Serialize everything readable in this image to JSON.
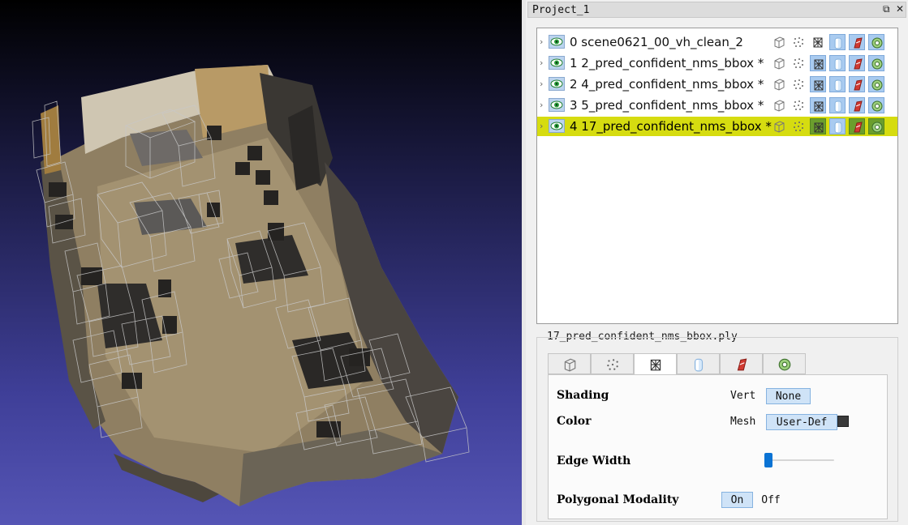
{
  "dock": {
    "title": "Project_1",
    "float_glyph": "⧉",
    "close_glyph": "✕"
  },
  "layers": [
    {
      "index": "0",
      "name": "scene0621_00_vh_clean_2",
      "selected": false
    },
    {
      "index": "1",
      "name": "2_pred_confident_nms_bbox *",
      "selected": false
    },
    {
      "index": "2",
      "name": "4_pred_confident_nms_bbox *",
      "selected": false
    },
    {
      "index": "3",
      "name": "5_pred_confident_nms_bbox *",
      "selected": false
    },
    {
      "index": "4",
      "name": "17_pred_confident_nms_bbox *",
      "selected": true
    }
  ],
  "layer_icons": [
    "box-icon",
    "points-icon",
    "wireframe-icon",
    "cylinder-icon",
    "red-brush-icon",
    "gear-icon"
  ],
  "properties": {
    "file_label": "17_pred_confident_nms_bbox.ply",
    "tabs": [
      "box-icon",
      "points-icon",
      "wireframe-icon",
      "cylinder-icon",
      "red-brush-icon",
      "gear-icon"
    ],
    "active_tab": 2,
    "shading_label": "Shading",
    "shading_mode": "Vert",
    "shading_value": "None",
    "color_label": "Color",
    "color_mode": "Mesh",
    "color_value": "User-Def",
    "color_swatch": "#3a3a3a",
    "edge_width_label": "Edge Width",
    "edge_width_fraction": 0.08,
    "polygonal_label": "Polygonal Modality",
    "polygonal_on": "On",
    "polygonal_off": "Off"
  },
  "colors": {
    "selection_row": "#d6dc10",
    "icon_active": "#a9cbf0",
    "viewport_bottom": "#5555b5"
  }
}
